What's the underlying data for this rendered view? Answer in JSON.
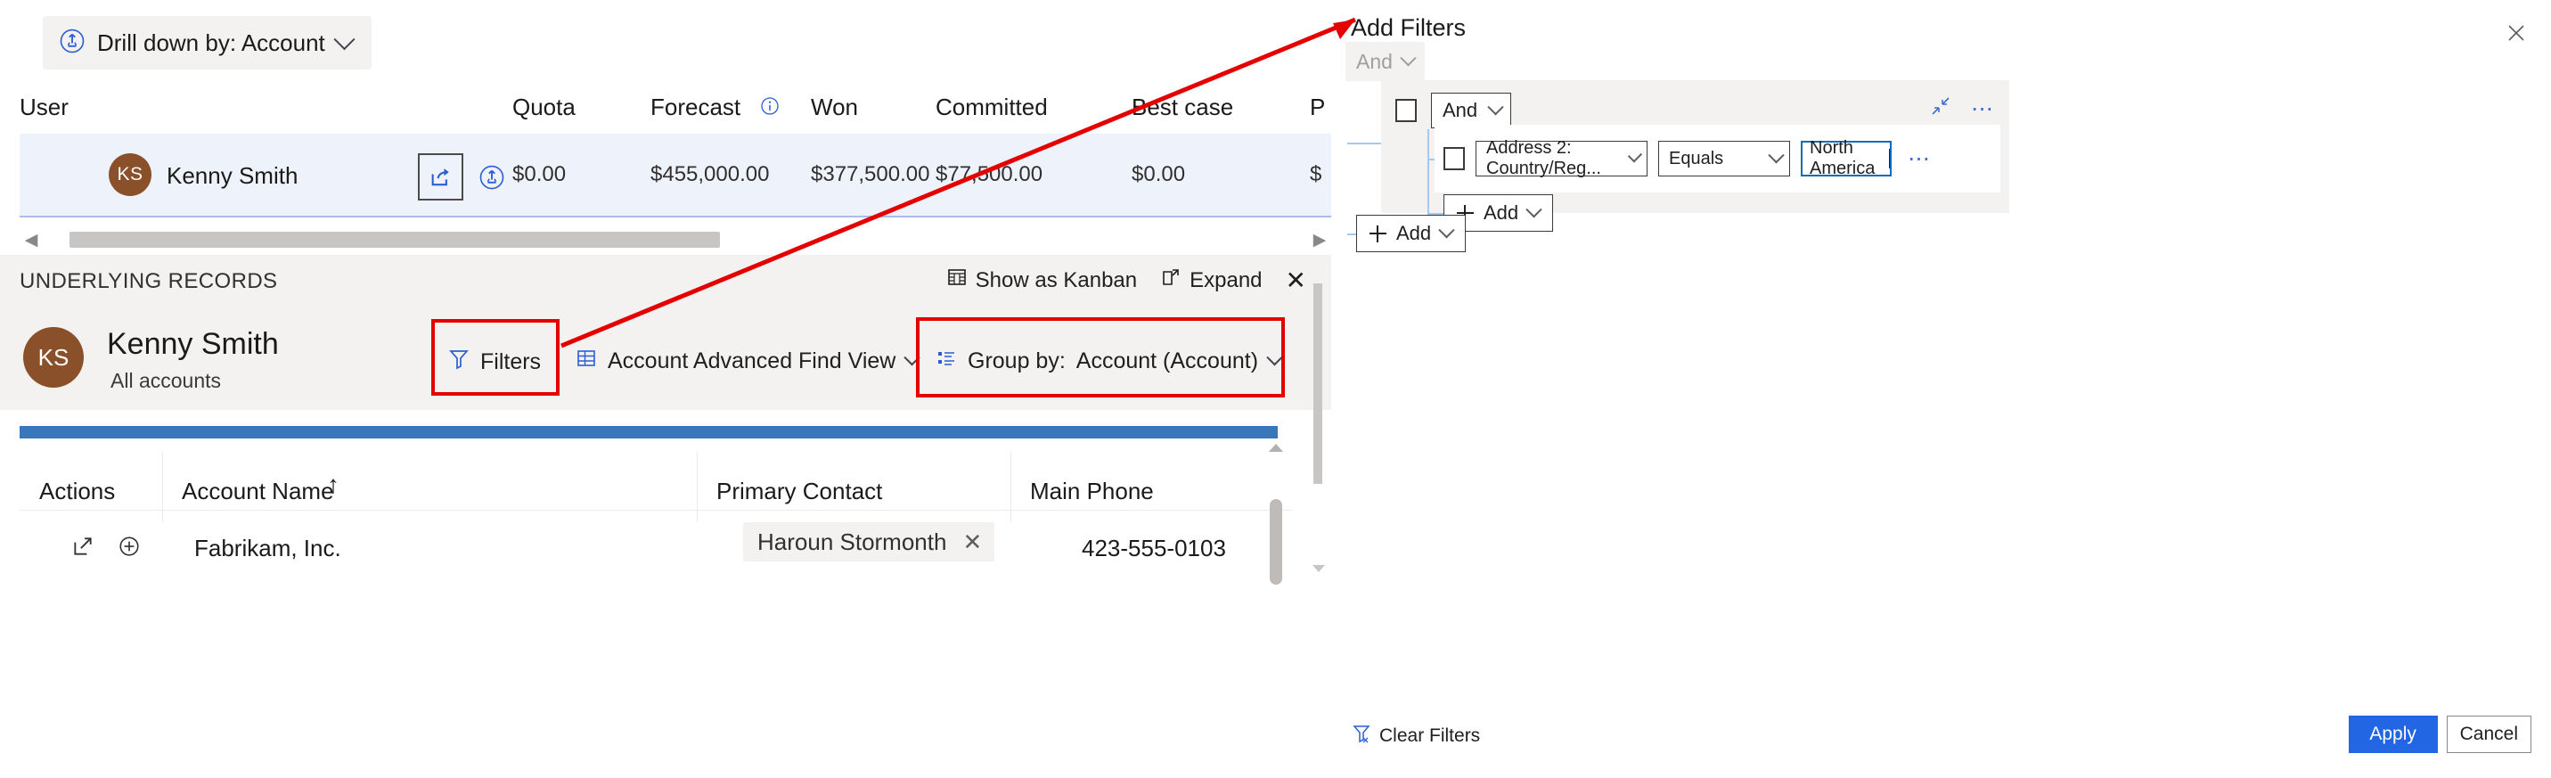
{
  "drilldown": {
    "icon": "drill-down-icon",
    "label": "Drill down by: Account",
    "chevron": "chevron-down-icon"
  },
  "forecast_grid": {
    "columns": [
      "User",
      "Quota",
      "Forecast",
      "Won",
      "Committed",
      "Best case",
      "P"
    ],
    "forecast_info_icon": "info-icon",
    "row": {
      "avatar_initials": "KS",
      "user": "Kenny Smith",
      "action_icons": [
        "open-record-icon",
        "drill-down-icon"
      ],
      "quota": "$0.00",
      "forecast": "$455,000.00",
      "won": "$377,500.00",
      "committed": "$77,500.00",
      "best_case": "$0.00",
      "next": "$"
    }
  },
  "underlying_records": {
    "title": "UNDERLYING RECORDS",
    "tools": [
      {
        "icon": "kanban-icon",
        "label": "Show as Kanban"
      },
      {
        "icon": "expand-icon",
        "label": "Expand"
      },
      {
        "icon": "close-icon",
        "label": "✕"
      }
    ]
  },
  "record_header": {
    "avatar_initials": "KS",
    "name": "Kenny Smith",
    "subtitle": "All accounts",
    "filters": {
      "icon": "filter-icon",
      "label": "Filters"
    },
    "view": {
      "icon": "grid-view-icon",
      "label": "Account Advanced Find View",
      "chevron": "chevron-down-icon"
    },
    "group_by": {
      "icon": "group-by-icon",
      "label": "Group by:",
      "value": "Account (Account)",
      "chevron": "chevron-down-icon"
    }
  },
  "records_grid": {
    "columns": [
      "Actions",
      "Account Name",
      "Primary Contact",
      "Main Phone"
    ],
    "sort_indicator": "↑",
    "rows": [
      {
        "actions": [
          "open-in-new-icon",
          "add-circle-icon"
        ],
        "account_name": "Fabrikam, Inc.",
        "primary_contact": "Haroun Stormonth",
        "primary_contact_remove": "✕",
        "main_phone": "423-555-0103"
      }
    ]
  },
  "filter_panel": {
    "title": "Add Filters",
    "close_icon": "close-icon",
    "root_operator": {
      "label": "And",
      "chevron": "chevron-down-icon"
    },
    "group": {
      "operator": {
        "label": "And",
        "chevron": "chevron-down-icon"
      },
      "collapse_icon": "collapse-icon",
      "more_icon": "more-options-icon",
      "condition": {
        "field": "Address 2: Country/Reg...",
        "field_chevron": "chevron-down-icon",
        "operator": "Equals",
        "operator_chevron": "chevron-down-icon",
        "value": "North America",
        "more_icon": "more-options-icon"
      },
      "add_button": {
        "icon": "plus-icon",
        "label": "Add",
        "chevron": "chevron-down-icon"
      }
    },
    "add_button": {
      "icon": "plus-icon",
      "label": "Add",
      "chevron": "chevron-down-icon"
    },
    "clear_filters": {
      "icon": "clear-filter-icon",
      "label": "Clear Filters"
    },
    "apply_label": "Apply",
    "cancel_label": "Cancel"
  },
  "colors": {
    "accent_blue": "#2266e3",
    "annotation_red": "#e50000",
    "row_highlight": "#eef2fb",
    "grid_topbar": "#3a77ba",
    "avatar_brown": "#8a5029",
    "panel_gray": "#f3f2f1"
  }
}
